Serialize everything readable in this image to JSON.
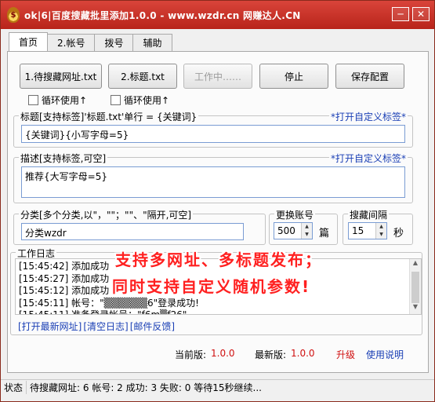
{
  "window": {
    "icon_glyph": "$",
    "title": "ok|6|百度搜藏批里添加1.0.0 - www.wzdr.cn 网赚达人.CN",
    "min_glyph": "─",
    "close_glyph": "✕"
  },
  "tabs": [
    "首页",
    "2.帐号",
    "拨号",
    "辅助"
  ],
  "toolbar": {
    "btn1": "1.待搜藏网址.txt",
    "btn2": "2.标题.txt",
    "btn3": "工作中……",
    "btn4": "停止",
    "btn5": "保存配置"
  },
  "loop": {
    "label1": "循环使用↑",
    "label2": "循环使用↑"
  },
  "title_group": {
    "legend": "标题[支持标签]'标题.txt'单行 = {关键词}",
    "link": "*打开自定义标签*",
    "value": "{关键词}{小写字母=5}"
  },
  "desc_group": {
    "legend": "描述[支持标签,可空]",
    "link": "*打开自定义标签*",
    "value": "推荐{大写字母=5}"
  },
  "category_group": {
    "legend": "分类[多个分类,以\"，\"\"；\"\"、\"隔开,可空]",
    "value": "分类wzdr"
  },
  "switch_group": {
    "legend": "更换账号",
    "value": "500",
    "unit": "篇"
  },
  "interval_group": {
    "legend": "搜藏间隔",
    "value": "15",
    "unit": "秒"
  },
  "log_group": {
    "legend": "工作日志",
    "lines": [
      "[15:45:42] 添加成功",
      "[15:45:27] 添加成功",
      "[15:45:12] 添加成功",
      "[15:45:11] 帐号：\"▒▒▒▒▒▒6\"登录成功!",
      "[15:45:11] 准备登录帐号：\"f6m▒f26\""
    ],
    "link1": "[打开最新网址]",
    "link2": "[清空日志]",
    "link3": "[邮件反馈]"
  },
  "overlay": {
    "line1": "支持多网址、多标题发布；",
    "line2": "同时支持自定义随机参数!"
  },
  "version": {
    "current_label": "当前版:",
    "current_value": "1.0.0",
    "latest_label": "最新版:",
    "latest_value": "1.0.0",
    "upgrade": "升级",
    "help": "使用说明"
  },
  "status": {
    "label": "状态",
    "text": "待搜藏网址: 6 帐号: 2 成功: 3 失败: 0 等待15秒继续..."
  }
}
